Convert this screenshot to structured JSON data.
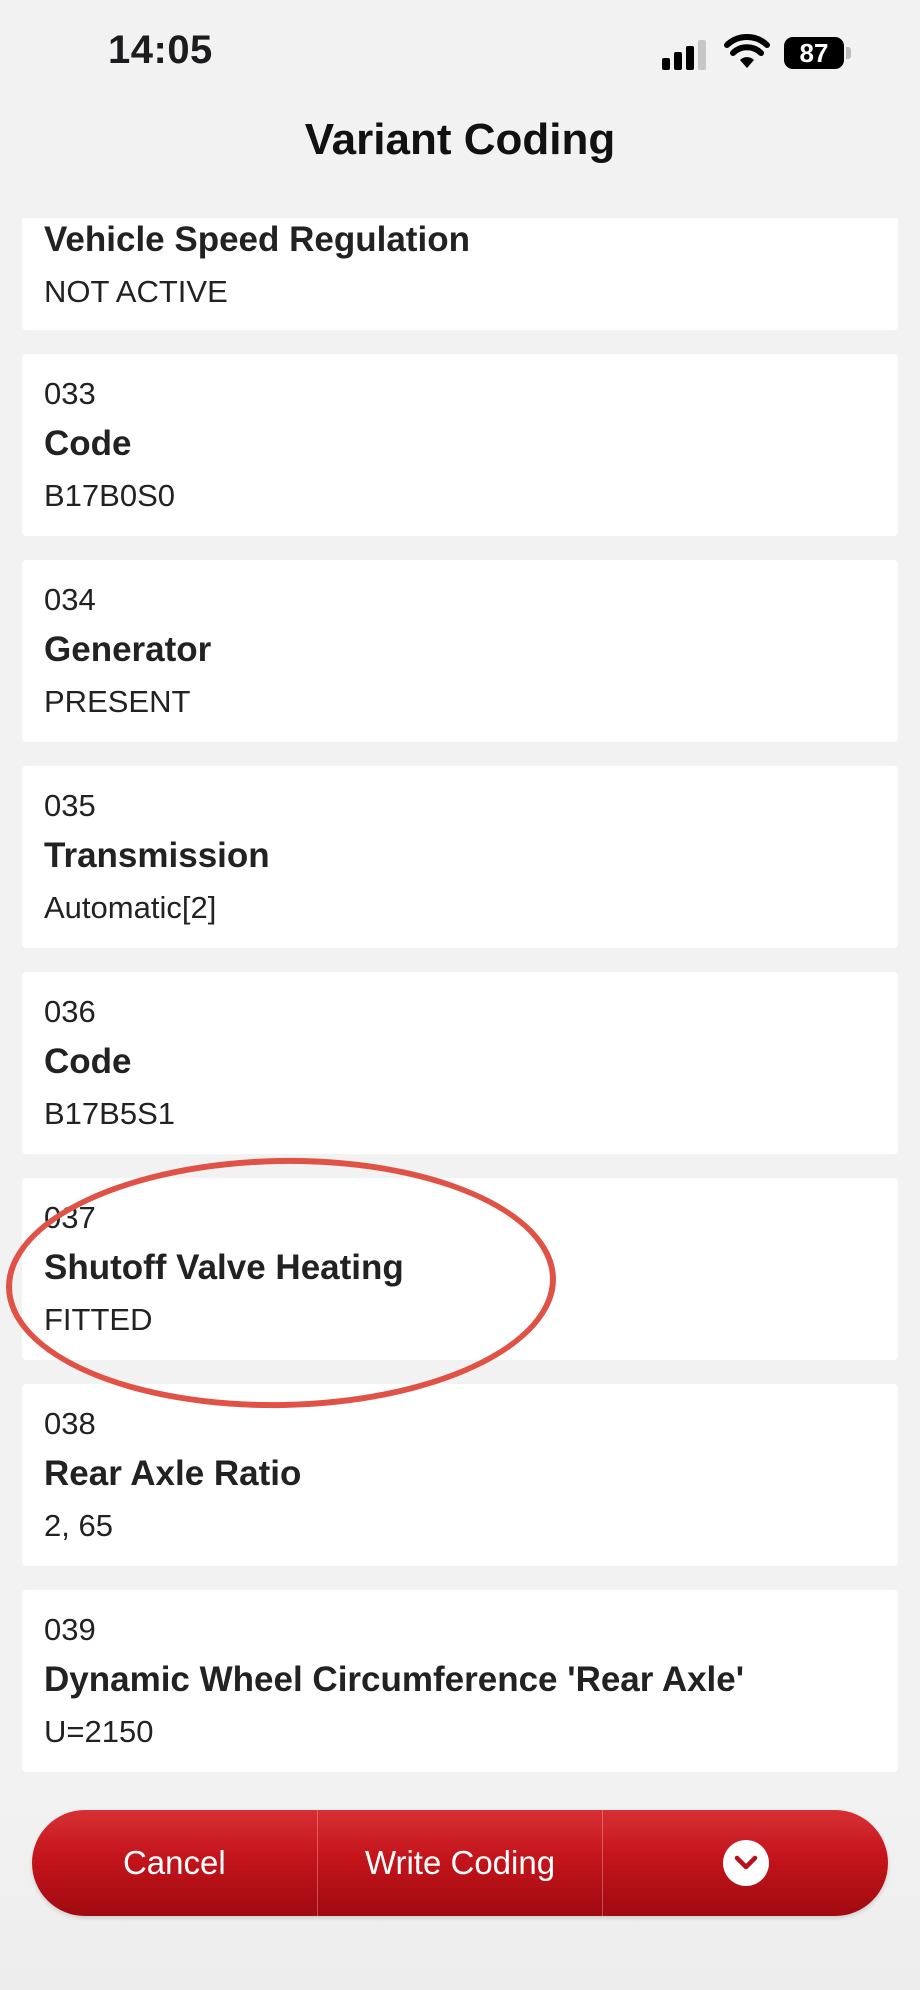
{
  "status_bar": {
    "time": "14:05",
    "battery": "87"
  },
  "nav": {
    "title": "Variant Coding"
  },
  "items": [
    {
      "number": "",
      "name": "Vehicle Speed Regulation",
      "value": "NOT ACTIVE"
    },
    {
      "number": "033",
      "name": "Code",
      "value": "B17B0S0"
    },
    {
      "number": "034",
      "name": "Generator",
      "value": "PRESENT"
    },
    {
      "number": "035",
      "name": "Transmission",
      "value": "Automatic[2]"
    },
    {
      "number": "036",
      "name": "Code",
      "value": "B17B5S1"
    },
    {
      "number": "037",
      "name": "Shutoff Valve Heating",
      "value": "FITTED"
    },
    {
      "number": "038",
      "name": "Rear Axle Ratio",
      "value": "2, 65"
    },
    {
      "number": "039",
      "name": "Dynamic Wheel Circumference 'Rear Axle'",
      "value": "U=2150"
    }
  ],
  "actions": {
    "cancel": "Cancel",
    "write": "Write Coding",
    "more_icon": "chevron-down-icon"
  },
  "colors": {
    "accent": "#c4141b",
    "highlight": "#e05245"
  }
}
